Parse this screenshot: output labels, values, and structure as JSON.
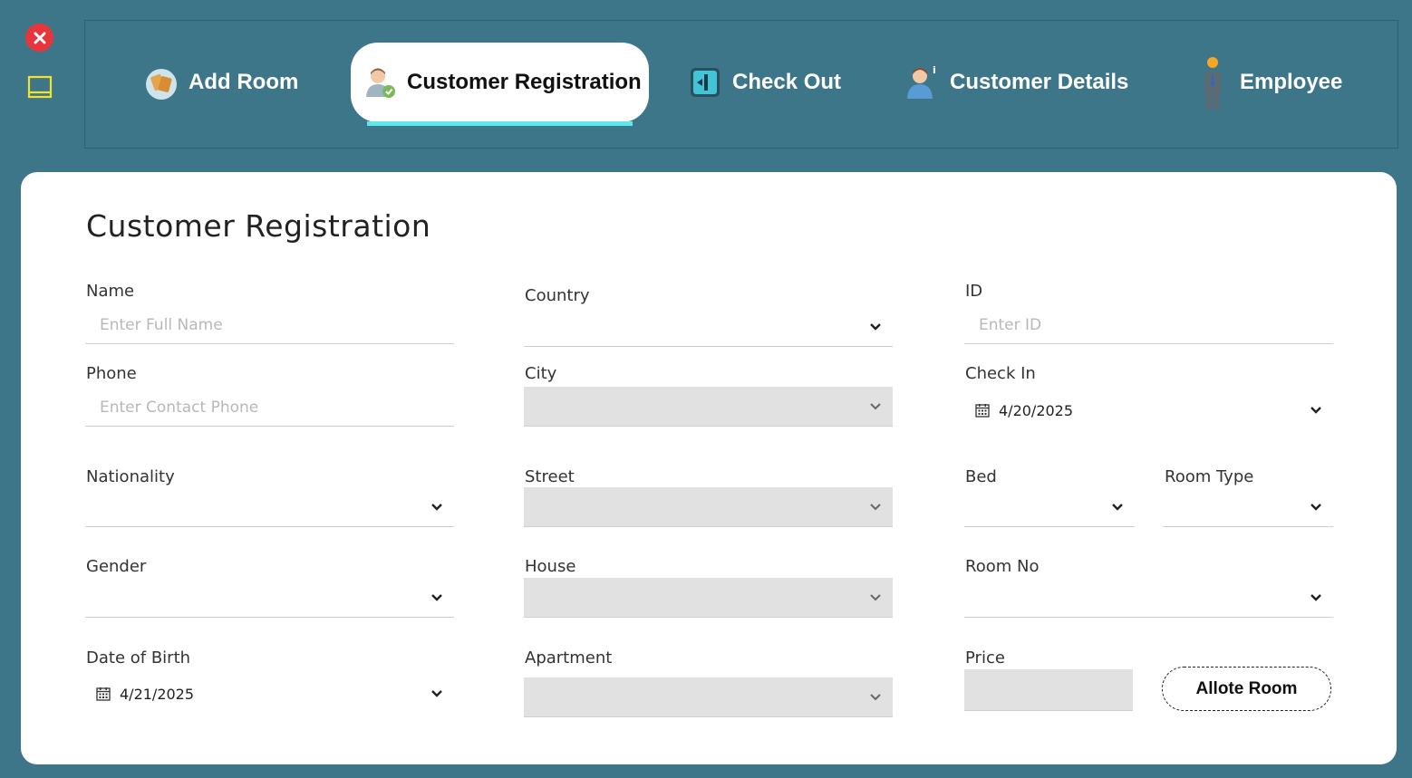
{
  "window": {
    "close_icon": "close-icon",
    "minimize_icon": "minimize-icon"
  },
  "nav": {
    "tabs": [
      {
        "label": "Add Room",
        "icon": "room-icon",
        "active": false
      },
      {
        "label": "Customer Registration",
        "icon": "customer-add-icon",
        "active": true
      },
      {
        "label": "Check Out",
        "icon": "exit-door-icon",
        "active": false
      },
      {
        "label": "Customer Details",
        "icon": "customer-info-icon",
        "active": false
      },
      {
        "label": "Employee",
        "icon": "employee-icon",
        "active": false
      }
    ]
  },
  "form": {
    "title": "Customer Registration",
    "name": {
      "label": "Name",
      "placeholder": "Enter Full Name",
      "value": ""
    },
    "phone": {
      "label": "Phone",
      "placeholder": "Enter Contact Phone",
      "value": ""
    },
    "nationality": {
      "label": "Nationality",
      "value": ""
    },
    "gender": {
      "label": "Gender",
      "value": ""
    },
    "dob": {
      "label": "Date of Birth",
      "value": "4/21/2025"
    },
    "country": {
      "label": "Country",
      "value": ""
    },
    "city": {
      "label": "City",
      "value": ""
    },
    "street": {
      "label": "Street",
      "value": ""
    },
    "house": {
      "label": "House",
      "value": ""
    },
    "apartment": {
      "label": "Apartment",
      "value": ""
    },
    "id": {
      "label": "ID",
      "placeholder": "Enter ID",
      "value": ""
    },
    "check_in": {
      "label": "Check In",
      "value": "4/20/2025"
    },
    "bed": {
      "label": "Bed",
      "value": ""
    },
    "room_type": {
      "label": "Room Type",
      "value": ""
    },
    "room_no": {
      "label": "Room No",
      "value": ""
    },
    "price": {
      "label": "Price",
      "value": ""
    },
    "allot_button": "Allote Room"
  },
  "colors": {
    "background": "#3e7689",
    "accent": "#5ee8ee",
    "close": "#e8353b",
    "minimize": "#f3e12a"
  }
}
